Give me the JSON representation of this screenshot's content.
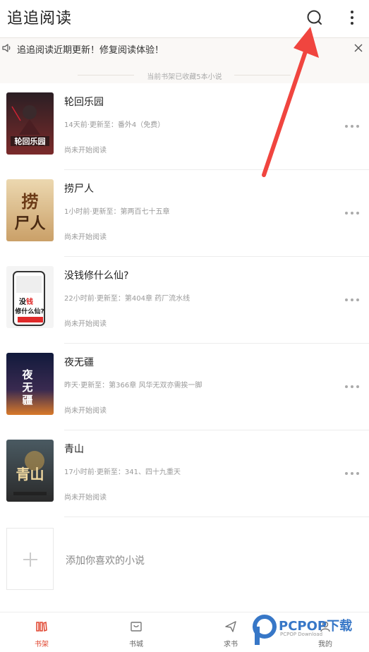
{
  "header": {
    "title": "追追阅读",
    "icons": [
      "search-icon",
      "more-vertical-icon"
    ]
  },
  "notice": {
    "text": "追追阅读近期更新！修复阅读体验！",
    "icons": [
      "speaker-icon",
      "close-icon"
    ]
  },
  "shelf": {
    "info": "当前书架已收藏5本小说"
  },
  "books": [
    {
      "title": "轮回乐园",
      "update": "14天前·更新至：番外4（免费）",
      "progress": "尚未开始阅读",
      "cover_text": "轮回乐园",
      "cover_colors": [
        "#1a1418",
        "#6b1f24"
      ]
    },
    {
      "title": "捞尸人",
      "update": "1小时前·更新至：第两百七十五章",
      "progress": "尚未开始阅读",
      "cover_text": "捞尸人",
      "cover_colors": [
        "#e6cfa0",
        "#c99a5a"
      ]
    },
    {
      "title": "没钱修什么仙?",
      "update": "22小时前·更新至：第404章 药厂流水线",
      "progress": "尚未开始阅读",
      "cover_text": "没钱修什么仙?",
      "cover_colors": [
        "#f3f3f3",
        "#d8d8d8"
      ]
    },
    {
      "title": "夜无疆",
      "update": "昨天·更新至：第366章 风华无双亦需挨一脚",
      "progress": "尚未开始阅读",
      "cover_text": "夜无疆",
      "cover_colors": [
        "#1a2048",
        "#d9742a"
      ]
    },
    {
      "title": "青山",
      "update": "17小时前·更新至：341、四十九重天",
      "progress": "尚未开始阅读",
      "cover_text": "青山",
      "cover_colors": [
        "#3a4a52",
        "#b98f3a"
      ]
    }
  ],
  "add": {
    "label": "添加你喜欢的小说"
  },
  "tabs": [
    {
      "label": "书架",
      "icon": "bookshelf-icon",
      "active": true
    },
    {
      "label": "书城",
      "icon": "store-icon",
      "active": false
    },
    {
      "label": "求书",
      "icon": "send-icon",
      "active": false
    },
    {
      "label": "我的",
      "icon": "profile-icon",
      "active": false
    }
  ],
  "watermark": {
    "brand": "PCPOP下载",
    "sub": "PCPOP Download"
  },
  "colors": {
    "accent": "#e0452f",
    "annotation_arrow": "#f0453f",
    "watermark": "#3777c7"
  }
}
